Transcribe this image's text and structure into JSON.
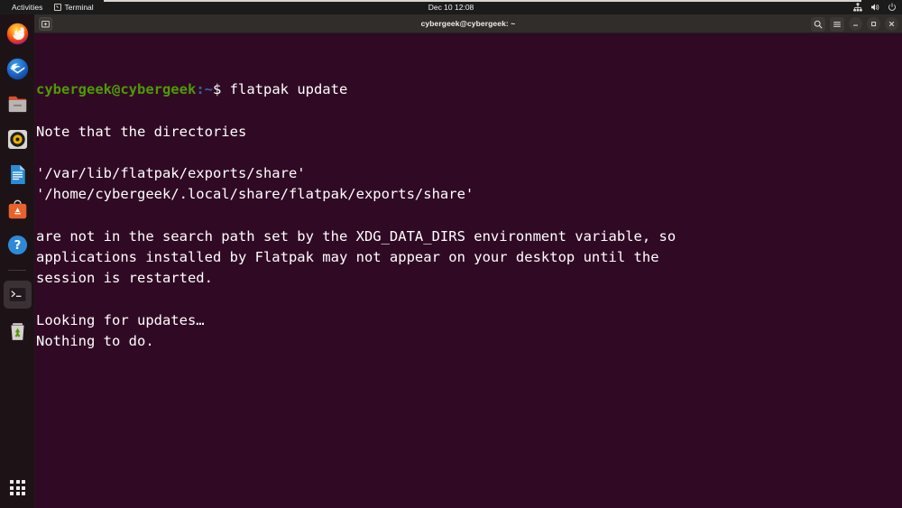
{
  "topbar": {
    "activities": "Activities",
    "app_name": "Terminal",
    "clock": "Dec 10  12:08",
    "icons": [
      "network-icon",
      "volume-icon",
      "power-icon"
    ]
  },
  "dock": {
    "items": [
      {
        "name": "firefox",
        "label": "Firefox"
      },
      {
        "name": "thunderbird",
        "label": "Thunderbird Mail"
      },
      {
        "name": "files",
        "label": "Files"
      },
      {
        "name": "rhythmbox",
        "label": "Rhythmbox"
      },
      {
        "name": "libreoffice-writer",
        "label": "LibreOffice Writer"
      },
      {
        "name": "ubuntu-software",
        "label": "Ubuntu Software"
      },
      {
        "name": "help",
        "label": "Help"
      },
      {
        "name": "terminal",
        "label": "Terminal"
      },
      {
        "name": "trash",
        "label": "Trash"
      }
    ],
    "show_apps_label": "Show Applications"
  },
  "window": {
    "title": "cybergeek@cybergeek: ~",
    "new_tab_label": "New Tab",
    "search_label": "Search",
    "menu_label": "Main Menu",
    "minimize_label": "Minimize",
    "maximize_label": "Restore",
    "close_label": "Close"
  },
  "terminal": {
    "prompt": {
      "user_host": "cybergeek@cybergeek",
      "path": ":~",
      "sigil": "$",
      "command": " flatpak update"
    },
    "lines": [
      "",
      "Note that the directories",
      "",
      "'/var/lib/flatpak/exports/share'",
      "'/home/cybergeek/.local/share/flatpak/exports/share'",
      "",
      "are not in the search path set by the XDG_DATA_DIRS environment variable, so",
      "applications installed by Flatpak may not appear on your desktop until the",
      "session is restarted.",
      "",
      "Looking for updates…",
      "Nothing to do."
    ]
  },
  "colors": {
    "terminal_bg": "#300a24",
    "dock_bg": "#1d1317",
    "topbar_bg": "#1b1b1b",
    "titlebar_bg": "#302d2b",
    "prompt_green": "#4e9a06",
    "prompt_blue": "#3465a4",
    "accent_orange": "#e95420",
    "text_white": "#ffffff"
  }
}
